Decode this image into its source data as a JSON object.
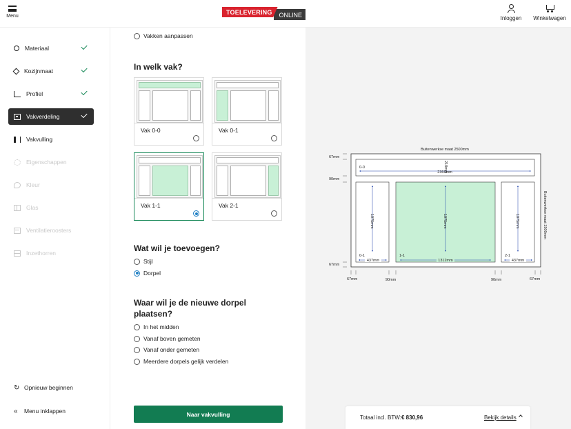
{
  "header": {
    "menu_label": "Menu",
    "logo_red": "TOELEVERING",
    "logo_dark": "ONLINE",
    "login_label": "Inloggen",
    "cart_label": "Winkelwagen"
  },
  "sidebar": {
    "items": [
      {
        "label": "Materiaal",
        "icon": "material-icon",
        "state": "done"
      },
      {
        "label": "Kozijnmaat",
        "icon": "frame-size-icon",
        "state": "done"
      },
      {
        "label": "Profiel",
        "icon": "profile-icon",
        "state": "done"
      },
      {
        "label": "Vakverdeling",
        "icon": "compartment-icon",
        "state": "active"
      },
      {
        "label": "Vakvulling",
        "icon": "fill-icon",
        "state": "enabled"
      },
      {
        "label": "Eigenschappen",
        "icon": "gear-icon",
        "state": "disabled"
      },
      {
        "label": "Kleur",
        "icon": "color-icon",
        "state": "disabled"
      },
      {
        "label": "Glas",
        "icon": "glass-icon",
        "state": "disabled"
      },
      {
        "label": "Ventilatieroosters",
        "icon": "vent-icon",
        "state": "disabled"
      },
      {
        "label": "Inzethorren",
        "icon": "screen-icon",
        "state": "disabled"
      }
    ],
    "restart_label": "Opnieuw beginnen",
    "collapse_label": "Menu inklappen"
  },
  "main": {
    "top_option": "Vakken aanpassen",
    "compartment_title": "In welk vak?",
    "compartments": [
      {
        "label": "Vak 0-0",
        "selected": false
      },
      {
        "label": "Vak 0-1",
        "selected": false
      },
      {
        "label": "Vak 1-1",
        "selected": true
      },
      {
        "label": "Vak 2-1",
        "selected": false
      }
    ],
    "add_title": "Wat wil je toevoegen?",
    "add_options": [
      {
        "label": "Stijl",
        "selected": false
      },
      {
        "label": "Dorpel",
        "selected": true
      }
    ],
    "place_title": "Waar wil je de nieuwe dorpel plaatsen?",
    "place_options": [
      {
        "label": "In het midden"
      },
      {
        "label": "Vanaf boven gemeten"
      },
      {
        "label": "Vanaf onder gemeten"
      },
      {
        "label": "Meerdere dorpels gelijk verdelen"
      }
    ],
    "cta_label": "Naar vakvulling"
  },
  "drawing": {
    "outer_width_label": "Buitenwerkse maat 2500mm",
    "outer_height_label": "Buitenwerkse maat 1500mm",
    "dim_top": "67mm",
    "dim_mid": "90mm",
    "dim_bottom": "67mm",
    "bottom_dims": [
      "67mm",
      "90mm",
      "90mm",
      "67mm"
    ],
    "cell_00": {
      "name": "0-0",
      "width": "2366mm",
      "height": "218mm"
    },
    "cell_01": {
      "name": "0-1",
      "width": "437mm",
      "height": "1075mm"
    },
    "cell_11": {
      "name": "1-1",
      "width": "1312mm",
      "height": "1075mm"
    },
    "cell_21": {
      "name": "2-1",
      "width": "437mm",
      "height": "1075mm"
    },
    "highlight_color": "#c8f0d6",
    "arrow_color": "#1a3fa8"
  },
  "footer": {
    "total_label": "Totaal incl. BTW:",
    "total_value": "€ 830,96",
    "details_label": "Bekijk details"
  }
}
